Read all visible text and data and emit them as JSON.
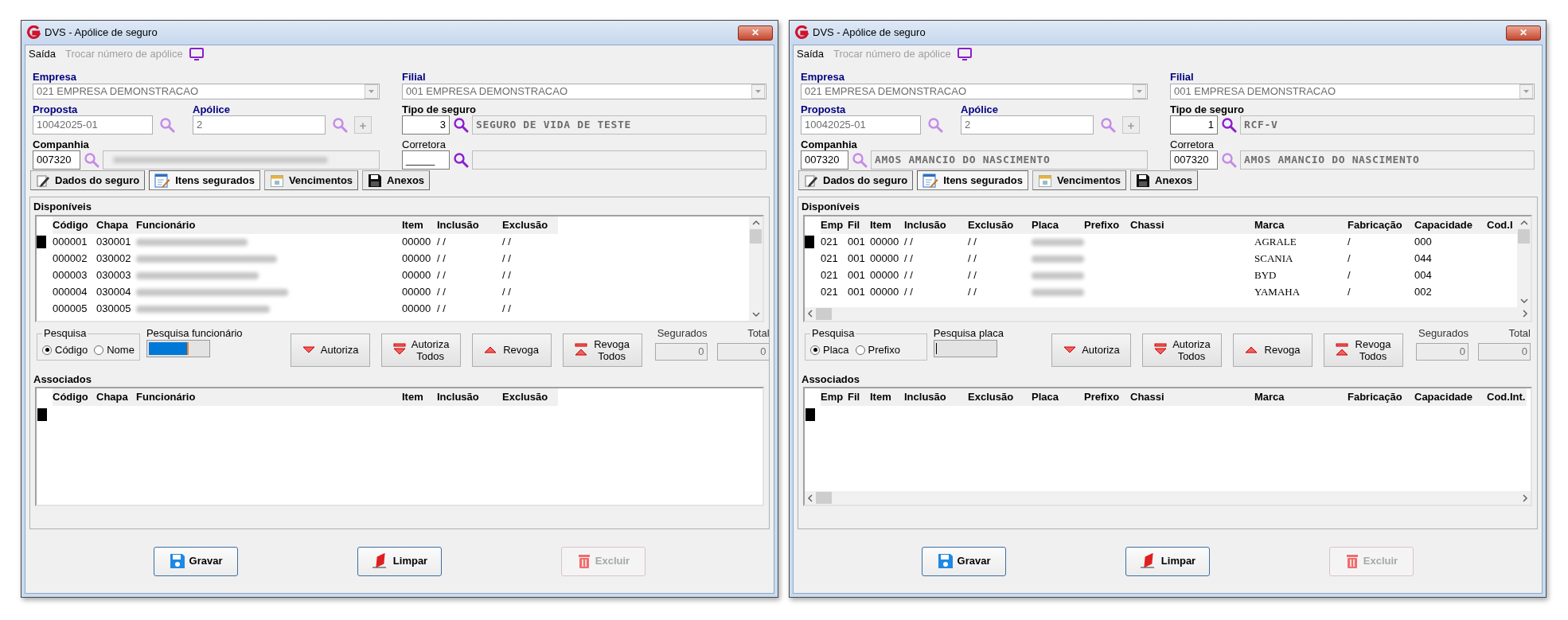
{
  "windows": [
    {
      "title": "DVS - Apólice de seguro",
      "close": "✕",
      "menu": [
        {
          "label": "Saída",
          "disabled": false
        },
        {
          "label": "Trocar número de apólice",
          "disabled": true
        }
      ],
      "form": {
        "empresa": {
          "label": "Empresa",
          "kind": "required",
          "value": "021 EMPRESA DEMONSTRACAO"
        },
        "filial": {
          "label": "Filial",
          "kind": "required",
          "value": "001 EMPRESA DEMONSTRACAO"
        },
        "proposta": {
          "label": "Proposta",
          "kind": "required",
          "value": "10042025-01",
          "search_enabled": false
        },
        "apolice": {
          "label": "Apólice",
          "kind": "required",
          "value": "2",
          "search_enabled": false,
          "add": "+"
        },
        "tipo": {
          "label": "Tipo de seguro",
          "kind": "bold",
          "code": "3",
          "description": "SEGURO DE VIDA DE TESTE",
          "search_enabled": true
        },
        "companhia": {
          "label": "Companhia",
          "kind": "bold",
          "code": "007320",
          "redacted": true,
          "search_enabled": false
        },
        "corretora": {
          "label": "Corretora",
          "kind": "normal",
          "code": "_____",
          "search_enabled": true
        }
      },
      "tabs": [
        {
          "label": "Dados do seguro",
          "kind": "edit",
          "selected": false
        },
        {
          "label": "Itens segurados",
          "kind": "list",
          "selected": true
        },
        {
          "label": "Vencimentos",
          "kind": "calendar",
          "selected": false
        },
        {
          "label": "Anexos",
          "kind": "save",
          "selected": false
        }
      ],
      "available": {
        "title": "Disponíveis",
        "kind": "employees",
        "horizontal_scrollbar": false,
        "columns": [
          {
            "label": "Código"
          },
          {
            "label": "Chapa"
          },
          {
            "label": "Funcionário",
            "redacted": true
          },
          {
            "label": "Item"
          },
          {
            "label": "Inclusão"
          },
          {
            "label": "Exclusão"
          }
        ],
        "rows": [
          {
            "current": true,
            "cells": [
              "000001",
              "030001",
              null,
              "00000",
              "/ /",
              "/ /"
            ]
          },
          {
            "current": false,
            "cells": [
              "000002",
              "030002",
              null,
              "00000",
              "/ /",
              "/ /"
            ]
          },
          {
            "current": false,
            "cells": [
              "000003",
              "030003",
              null,
              "00000",
              "/ /",
              "/ /"
            ]
          },
          {
            "current": false,
            "cells": [
              "000004",
              "030004",
              null,
              "00000",
              "/ /",
              "/ /"
            ]
          },
          {
            "current": false,
            "cells": [
              "000005",
              "030005",
              null,
              "00000",
              "/ /",
              "/ /"
            ]
          }
        ]
      },
      "search": {
        "title": "Pesquisa",
        "options": [
          {
            "label": "Código",
            "selected": true
          },
          {
            "label": "Nome",
            "selected": false
          }
        ],
        "field_label": "Pesquisa funcionário",
        "highlighted": true
      },
      "actions": [
        {
          "label": "Autoriza",
          "kind": "down"
        },
        {
          "label": "Autoriza Todos",
          "kind": "down_all"
        },
        {
          "label": "Revoga",
          "kind": "up"
        },
        {
          "label": "Revoga Todos",
          "kind": "up_all"
        }
      ],
      "counters": [
        {
          "label": "Segurados",
          "value": "0"
        },
        {
          "label": "Total",
          "value": "0"
        }
      ],
      "associated": {
        "title": "Associados",
        "kind": "employees",
        "horizontal_scrollbar": false,
        "current_row_marker": true,
        "columns": [
          {
            "label": "Código"
          },
          {
            "label": "Chapa"
          },
          {
            "label": "Funcionário"
          },
          {
            "label": "Item"
          },
          {
            "label": "Inclusão"
          },
          {
            "label": "Exclusão"
          }
        ]
      },
      "footer": [
        {
          "label": "Gravar",
          "kind": "save",
          "disabled": false
        },
        {
          "label": "Limpar",
          "kind": "clear",
          "disabled": false
        },
        {
          "label": "Excluir",
          "kind": "delete",
          "disabled": true
        }
      ]
    },
    {
      "title": "DVS - Apólice de seguro",
      "close": "✕",
      "menu": [
        {
          "label": "Saída",
          "disabled": false
        },
        {
          "label": "Trocar número de apólice",
          "disabled": true
        }
      ],
      "form": {
        "empresa": {
          "label": "Empresa",
          "kind": "required",
          "value": "021 EMPRESA DEMONSTRACAO"
        },
        "filial": {
          "label": "Filial",
          "kind": "required",
          "value": "001 EMPRESA DEMONSTRACAO"
        },
        "proposta": {
          "label": "Proposta",
          "kind": "required",
          "value": "10042025-01",
          "search_enabled": false
        },
        "apolice": {
          "label": "Apólice",
          "kind": "required",
          "value": "2",
          "search_enabled": false,
          "add": "+"
        },
        "tipo": {
          "label": "Tipo de seguro",
          "kind": "bold",
          "code": "1",
          "description": "RCF-V",
          "search_enabled": true
        },
        "companhia": {
          "label": "Companhia",
          "kind": "bold",
          "code": "007320",
          "description": "AMOS AMANCIO DO NASCIMENTO",
          "search_enabled": false
        },
        "corretora": {
          "label": "Corretora",
          "kind": "normal",
          "code": "007320",
          "description": "AMOS AMANCIO DO NASCIMENTO",
          "search_enabled": false
        }
      },
      "tabs": [
        {
          "label": "Dados do seguro",
          "kind": "edit",
          "selected": false
        },
        {
          "label": "Itens segurados",
          "kind": "list",
          "selected": true
        },
        {
          "label": "Vencimentos",
          "kind": "calendar",
          "selected": false
        },
        {
          "label": "Anexos",
          "kind": "save",
          "selected": false
        }
      ],
      "available": {
        "title": "Disponíveis",
        "kind": "vehicles",
        "horizontal_scrollbar": true,
        "columns": [
          {
            "label": "Emp"
          },
          {
            "label": "Fil"
          },
          {
            "label": "Item"
          },
          {
            "label": "Inclusão"
          },
          {
            "label": "Exclusão"
          },
          {
            "label": "Placa",
            "redacted": true
          },
          {
            "label": "Prefixo"
          },
          {
            "label": "Chassi"
          },
          {
            "label": "Marca"
          },
          {
            "label": "Fabricação"
          },
          {
            "label": "Capacidade"
          },
          {
            "label": "Cod.I"
          }
        ],
        "rows": [
          {
            "current": true,
            "cells": [
              "021",
              "001",
              "00000",
              "/ /",
              "/ /",
              null,
              null,
              null,
              "AGRALE",
              "/",
              "000",
              null
            ]
          },
          {
            "current": false,
            "cells": [
              "021",
              "001",
              "00000",
              "/ /",
              "/ /",
              null,
              null,
              null,
              "SCANIA",
              "/",
              "044",
              null
            ]
          },
          {
            "current": false,
            "cells": [
              "021",
              "001",
              "00000",
              "/ /",
              "/ /",
              null,
              null,
              null,
              "BYD",
              "/",
              "004",
              null
            ]
          },
          {
            "current": false,
            "cells": [
              "021",
              "001",
              "00000",
              "/ /",
              "/ /",
              null,
              null,
              null,
              "YAMAHA",
              "/",
              "002",
              null
            ]
          }
        ]
      },
      "search": {
        "title": "Pesquisa",
        "options": [
          {
            "label": "Placa",
            "selected": true
          },
          {
            "label": "Prefixo",
            "selected": false
          }
        ],
        "field_label": "Pesquisa placa",
        "highlighted": false
      },
      "actions": [
        {
          "label": "Autoriza",
          "kind": "down"
        },
        {
          "label": "Autoriza Todos",
          "kind": "down_all"
        },
        {
          "label": "Revoga",
          "kind": "up"
        },
        {
          "label": "Revoga Todos",
          "kind": "up_all"
        }
      ],
      "counters": [
        {
          "label": "Segurados",
          "value": "0"
        },
        {
          "label": "Total",
          "value": "0"
        }
      ],
      "associated": {
        "title": "Associados",
        "kind": "vehicles",
        "horizontal_scrollbar": true,
        "current_row_marker": true,
        "columns": [
          {
            "label": "Emp"
          },
          {
            "label": "Fil"
          },
          {
            "label": "Item"
          },
          {
            "label": "Inclusão"
          },
          {
            "label": "Exclusão"
          },
          {
            "label": "Placa"
          },
          {
            "label": "Prefixo"
          },
          {
            "label": "Chassi"
          },
          {
            "label": "Marca"
          },
          {
            "label": "Fabricação"
          },
          {
            "label": "Capacidade"
          },
          {
            "label": "Cod.Int."
          }
        ]
      },
      "footer": [
        {
          "label": "Gravar",
          "kind": "save",
          "disabled": false
        },
        {
          "label": "Limpar",
          "kind": "clear",
          "disabled": false
        },
        {
          "label": "Excluir",
          "kind": "delete",
          "disabled": true
        }
      ]
    }
  ]
}
